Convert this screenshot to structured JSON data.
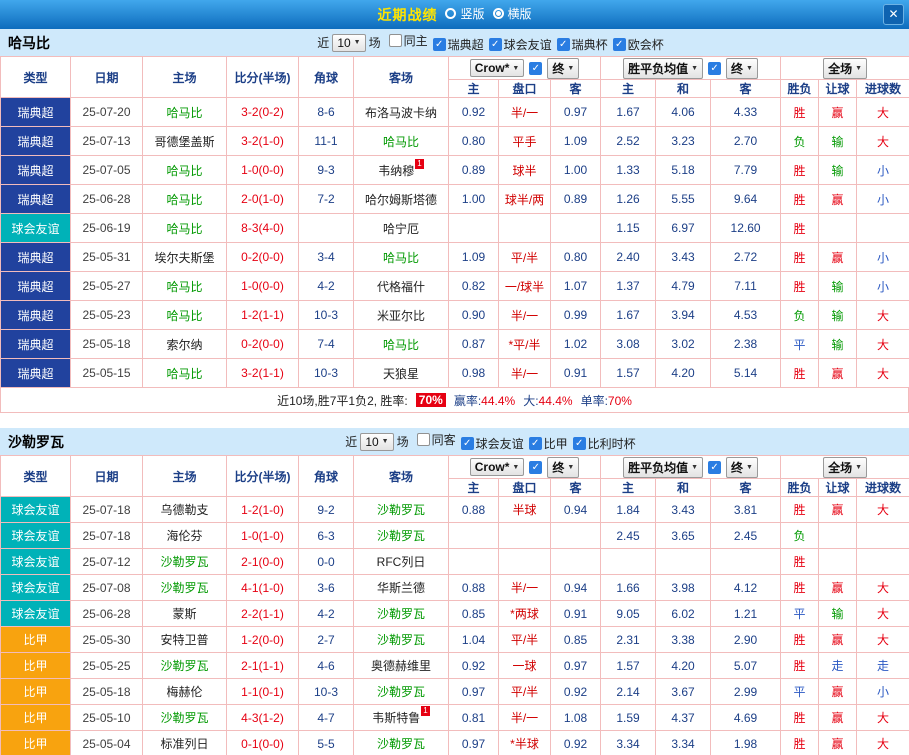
{
  "titlebar": {
    "title": "近期战绩",
    "close": "✕",
    "radio_options": [
      {
        "name": "vertical",
        "label": "竖版",
        "selected": false
      },
      {
        "name": "horizontal",
        "label": "横版",
        "selected": true
      }
    ]
  },
  "table": {
    "base": [
      "类型",
      "日期",
      "主场",
      "比分(半场)",
      "角球",
      "客场"
    ],
    "sub": [
      "主",
      "盘口",
      "客",
      "主",
      "和",
      "客",
      "胜负",
      "让球",
      "进球数"
    ],
    "odds_select": "Crow*",
    "final_select": "终",
    "mean_select": "胜平负均值",
    "full_select": "全场"
  },
  "colors": {
    "league": {
      "瑞典超": "#21429e",
      "球会友谊": "#00b2b8",
      "比甲": "#f8a30f"
    },
    "result": {
      "胜": "#e60012",
      "负": "#009900",
      "平": "#2b59c3",
      "赢": "#e60012",
      "输": "#009900",
      "走": "#2b59c3",
      "大": "#e60012",
      "小": "#2b59c3"
    },
    "score_red": "#e60012",
    "team_green": "#009900",
    "odds_navy": "#1c3f87"
  },
  "sections": [
    {
      "team": "哈马比",
      "filter": {
        "near_label": "近",
        "count": "10",
        "unit_label": "场",
        "checkboxes": [
          {
            "name": "same-home",
            "label": "同主",
            "checked": false
          },
          {
            "name": "swedish-allsvenskan",
            "label": "瑞典超",
            "checked": true
          },
          {
            "name": "club-friendly",
            "label": "球会友谊",
            "checked": true
          },
          {
            "name": "swedish-cup",
            "label": "瑞典杯",
            "checked": true
          },
          {
            "name": "conference-league",
            "label": "欧会杯",
            "checked": true
          }
        ]
      },
      "rows": [
        {
          "league": "瑞典超",
          "date": "25-07-20",
          "home": "哈马比",
          "score": "3-2(0-2)",
          "corner": "8-6",
          "away": "布洛马波卡纳",
          "o1": "0.92",
          "hcap": "半/一",
          "o2": "0.97",
          "m1": "1.67",
          "m2": "4.06",
          "m3": "4.33",
          "r1": "胜",
          "r2": "赢",
          "r3": "大"
        },
        {
          "league": "瑞典超",
          "date": "25-07-13",
          "home": "哥德堡盖斯",
          "score": "3-2(1-0)",
          "corner": "11-1",
          "away": "哈马比",
          "o1": "0.80",
          "hcap": "平手",
          "o2": "1.09",
          "m1": "2.52",
          "m2": "3.23",
          "m3": "2.70",
          "r1": "负",
          "r2": "输",
          "r3": "大"
        },
        {
          "league": "瑞典超",
          "date": "25-07-05",
          "home": "哈马比",
          "score": "1-0(0-0)",
          "corner": "9-3",
          "away": "韦纳穆",
          "away_badge": "1",
          "o1": "0.89",
          "hcap": "球半",
          "o2": "1.00",
          "m1": "1.33",
          "m2": "5.18",
          "m3": "7.79",
          "r1": "胜",
          "r2": "输",
          "r3": "小"
        },
        {
          "league": "瑞典超",
          "date": "25-06-28",
          "home": "哈马比",
          "score": "2-0(1-0)",
          "corner": "7-2",
          "away": "哈尔姆斯塔德",
          "o1": "1.00",
          "hcap": "球半/两",
          "o2": "0.89",
          "m1": "1.26",
          "m2": "5.55",
          "m3": "9.64",
          "r1": "胜",
          "r2": "赢",
          "r3": "小"
        },
        {
          "league": "球会友谊",
          "date": "25-06-19",
          "home": "哈马比",
          "score": "8-3(4-0)",
          "corner": "",
          "away": "哈宁厄",
          "o1": "",
          "hcap": "",
          "o2": "",
          "m1": "1.15",
          "m2": "6.97",
          "m3": "12.60",
          "r1": "胜",
          "r2": "",
          "r3": ""
        },
        {
          "league": "瑞典超",
          "date": "25-05-31",
          "home": "埃尔夫斯堡",
          "score": "0-2(0-0)",
          "corner": "3-4",
          "away": "哈马比",
          "o1": "1.09",
          "hcap": "平/半",
          "o2": "0.80",
          "m1": "2.40",
          "m2": "3.43",
          "m3": "2.72",
          "r1": "胜",
          "r2": "赢",
          "r3": "小"
        },
        {
          "league": "瑞典超",
          "date": "25-05-27",
          "home": "哈马比",
          "score": "1-0(0-0)",
          "corner": "4-2",
          "away": "代格福什",
          "o1": "0.82",
          "hcap": "一/球半",
          "o2": "1.07",
          "m1": "1.37",
          "m2": "4.79",
          "m3": "7.11",
          "r1": "胜",
          "r2": "输",
          "r3": "小"
        },
        {
          "league": "瑞典超",
          "date": "25-05-23",
          "home": "哈马比",
          "score": "1-2(1-1)",
          "corner": "10-3",
          "away": "米亚尔比",
          "o1": "0.90",
          "hcap": "半/一",
          "o2": "0.99",
          "m1": "1.67",
          "m2": "3.94",
          "m3": "4.53",
          "r1": "负",
          "r2": "输",
          "r3": "大"
        },
        {
          "league": "瑞典超",
          "date": "25-05-18",
          "home": "索尔纳",
          "score": "0-2(0-0)",
          "corner": "7-4",
          "away": "哈马比",
          "o1": "0.87",
          "hcap": "*平/半",
          "o2": "1.02",
          "m1": "3.08",
          "m2": "3.02",
          "m3": "2.38",
          "r1": "平",
          "r2": "输",
          "r3": "大"
        },
        {
          "league": "瑞典超",
          "date": "25-05-15",
          "home": "哈马比",
          "score": "3-2(1-1)",
          "corner": "10-3",
          "away": "天狼星",
          "o1": "0.98",
          "hcap": "半/一",
          "o2": "0.91",
          "m1": "1.57",
          "m2": "4.20",
          "m3": "5.14",
          "r1": "胜",
          "r2": "赢",
          "r3": "大"
        }
      ],
      "summary": {
        "prefix": "近10场,胜7平1负2,  胜率:",
        "win_rate": "70%",
        "stats": [
          {
            "label": "赢率:",
            "value": "44.4%"
          },
          {
            "label": "大:",
            "value": "44.4%"
          },
          {
            "label": "单率:",
            "value": "70%"
          }
        ]
      }
    },
    {
      "team": "沙勒罗瓦",
      "filter": {
        "near_label": "近",
        "count": "10",
        "unit_label": "场",
        "checkboxes": [
          {
            "name": "same-away",
            "label": "同客",
            "checked": false
          },
          {
            "name": "club-friendly",
            "label": "球会友谊",
            "checked": true
          },
          {
            "name": "belgian-pro-league",
            "label": "比甲",
            "checked": true
          },
          {
            "name": "belgian-cup",
            "label": "比利时杯",
            "checked": true
          }
        ]
      },
      "rows": [
        {
          "league": "球会友谊",
          "date": "25-07-18",
          "home": "乌德勒支",
          "score": "1-2(1-0)",
          "corner": "9-2",
          "away": "沙勒罗瓦",
          "o1": "0.88",
          "hcap": "半球",
          "o2": "0.94",
          "m1": "1.84",
          "m2": "3.43",
          "m3": "3.81",
          "r1": "胜",
          "r2": "赢",
          "r3": "大"
        },
        {
          "league": "球会友谊",
          "date": "25-07-18",
          "home": "海伦芬",
          "score": "1-0(1-0)",
          "corner": "6-3",
          "away": "沙勒罗瓦",
          "o1": "",
          "hcap": "",
          "o2": "",
          "m1": "2.45",
          "m2": "3.65",
          "m3": "2.45",
          "r1": "负",
          "r2": "",
          "r3": ""
        },
        {
          "league": "球会友谊",
          "date": "25-07-12",
          "home": "沙勒罗瓦",
          "score": "2-1(0-0)",
          "corner": "0-0",
          "away": "RFC列日",
          "o1": "",
          "hcap": "",
          "o2": "",
          "m1": "",
          "m2": "",
          "m3": "",
          "r1": "胜",
          "r2": "",
          "r3": ""
        },
        {
          "league": "球会友谊",
          "date": "25-07-08",
          "home": "沙勒罗瓦",
          "score": "4-1(1-0)",
          "corner": "3-6",
          "away": "华斯兰德",
          "o1": "0.88",
          "hcap": "半/一",
          "o2": "0.94",
          "m1": "1.66",
          "m2": "3.98",
          "m3": "4.12",
          "r1": "胜",
          "r2": "赢",
          "r3": "大"
        },
        {
          "league": "球会友谊",
          "date": "25-06-28",
          "home": "蒙斯",
          "score": "2-2(1-1)",
          "corner": "4-2",
          "away": "沙勒罗瓦",
          "o1": "0.85",
          "hcap": "*两球",
          "o2": "0.91",
          "m1": "9.05",
          "m2": "6.02",
          "m3": "1.21",
          "r1": "平",
          "r2": "输",
          "r3": "大"
        },
        {
          "league": "比甲",
          "date": "25-05-30",
          "home": "安特卫普",
          "score": "1-2(0-0)",
          "corner": "2-7",
          "away": "沙勒罗瓦",
          "o1": "1.04",
          "hcap": "平/半",
          "o2": "0.85",
          "m1": "2.31",
          "m2": "3.38",
          "m3": "2.90",
          "r1": "胜",
          "r2": "赢",
          "r3": "大"
        },
        {
          "league": "比甲",
          "date": "25-05-25",
          "home": "沙勒罗瓦",
          "score": "2-1(1-1)",
          "corner": "4-6",
          "away": "奥德赫维里",
          "o1": "0.92",
          "hcap": "一球",
          "o2": "0.97",
          "m1": "1.57",
          "m2": "4.20",
          "m3": "5.07",
          "r1": "胜",
          "r2": "走",
          "r3": "走"
        },
        {
          "league": "比甲",
          "date": "25-05-18",
          "home": "梅赫伦",
          "score": "1-1(0-1)",
          "corner": "10-3",
          "away": "沙勒罗瓦",
          "o1": "0.97",
          "hcap": "平/半",
          "o2": "0.92",
          "m1": "2.14",
          "m2": "3.67",
          "m3": "2.99",
          "r1": "平",
          "r2": "赢",
          "r3": "小"
        },
        {
          "league": "比甲",
          "date": "25-05-10",
          "home": "沙勒罗瓦",
          "score": "4-3(1-2)",
          "corner": "4-7",
          "away": "韦斯特鲁",
          "away_badge": "1",
          "o1": "0.81",
          "hcap": "半/一",
          "o2": "1.08",
          "m1": "1.59",
          "m2": "4.37",
          "m3": "4.69",
          "r1": "胜",
          "r2": "赢",
          "r3": "大"
        },
        {
          "league": "比甲",
          "date": "25-05-04",
          "home": "标准列日",
          "score": "0-1(0-0)",
          "corner": "5-5",
          "away": "沙勒罗瓦",
          "o1": "0.97",
          "hcap": "*半球",
          "o2": "0.92",
          "m1": "3.34",
          "m2": "3.34",
          "m3": "1.98",
          "r1": "胜",
          "r2": "赢",
          "r3": "大"
        }
      ]
    }
  ]
}
